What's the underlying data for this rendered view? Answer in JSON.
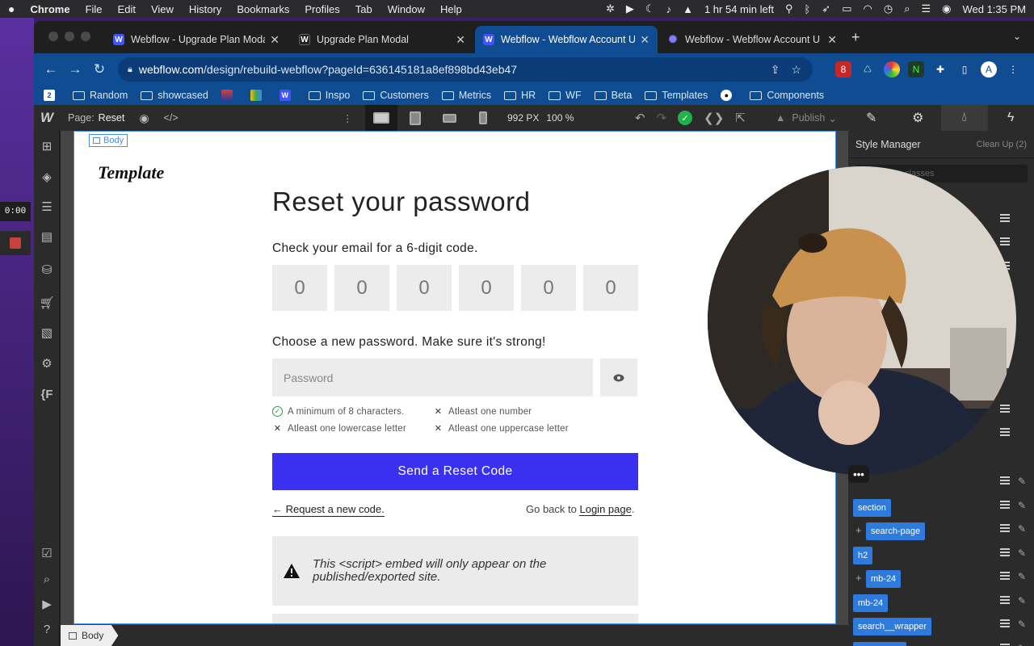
{
  "menubar": {
    "app": "Chrome",
    "items": [
      "File",
      "Edit",
      "View",
      "History",
      "Bookmarks",
      "Profiles",
      "Tab",
      "Window",
      "Help"
    ],
    "battery_text": "1 hr 54 min left",
    "datetime": "Wed  1:35 PM"
  },
  "recorder": {
    "time": "0:00"
  },
  "tabs": [
    {
      "label": "Webflow - Upgrade Plan Modal",
      "icon": "webflow-icon",
      "color": "#4353ff",
      "active": false
    },
    {
      "label": "Upgrade Plan Modal",
      "icon": "webflow-icon",
      "color": "#222222",
      "active": false
    },
    {
      "label": "Webflow - Webflow Account UI",
      "icon": "webflow-icon",
      "color": "#4353ff",
      "active": true
    },
    {
      "label": "Webflow - Webflow Account U",
      "icon": "gear-icon",
      "color": "#4353ff",
      "active": false
    }
  ],
  "address": {
    "host": "webflow.com",
    "path": "/design/rebuild-webflow?pageId=636145181a8ef898bd43eb47"
  },
  "bookmarks": [
    {
      "label": "",
      "kind": "app-icon"
    },
    {
      "label": "Random",
      "kind": "folder"
    },
    {
      "label": "showcased",
      "kind": "folder"
    },
    {
      "label": "",
      "kind": "app-icon"
    },
    {
      "label": "",
      "kind": "app-icon"
    },
    {
      "label": "",
      "kind": "webflow-icon"
    },
    {
      "label": "Inspo",
      "kind": "folder"
    },
    {
      "label": "Customers",
      "kind": "folder"
    },
    {
      "label": "Metrics",
      "kind": "folder"
    },
    {
      "label": "HR",
      "kind": "folder"
    },
    {
      "label": "WF",
      "kind": "folder"
    },
    {
      "label": "Beta",
      "kind": "folder"
    },
    {
      "label": "Templates",
      "kind": "folder"
    },
    {
      "label": "",
      "kind": "app-icon"
    },
    {
      "label": "Components",
      "kind": "folder"
    }
  ],
  "designer": {
    "page_label": "Page:",
    "page_name": "Reset",
    "width": "992 PX",
    "zoom": "100 %",
    "publish": "Publish",
    "body_tag": "Body",
    "breadcrumb": "Body"
  },
  "content": {
    "brand": "Template",
    "title": "Reset your password",
    "code_prompt": "Check your email for a 6-digit code.",
    "digits": [
      "0",
      "0",
      "0",
      "0",
      "0",
      "0"
    ],
    "pw_prompt": "Choose a new password. Make sure it's strong!",
    "pw_placeholder": "Password",
    "requirements": [
      {
        "text": "A minimum of 8 characters.",
        "met": true
      },
      {
        "text": "Atleast one number",
        "met": false
      },
      {
        "text": "Atleast one lowercase letter",
        "met": false
      },
      {
        "text": "Atleast one uppercase letter",
        "met": false
      }
    ],
    "send_button": "Send a Reset Code",
    "request_link": "← Request a new code.",
    "go_back_text": "Go back to ",
    "login_link": "Login page",
    "period": ".",
    "embed_notice": "This <script> embed will only appear on the published/exported site."
  },
  "style_manager": {
    "title": "Style Manager",
    "cleanup": "Clean Up (2)",
    "search_placeholder": "classes",
    "classes": [
      {
        "name": "section",
        "plus": false
      },
      {
        "name": "search-page",
        "plus": true
      },
      {
        "name": "h2",
        "plus": false
      },
      {
        "name": "mb-24",
        "plus": true
      },
      {
        "name": "mb-24",
        "plus": false
      },
      {
        "name": "search__wrapper",
        "plus": false
      },
      {
        "name": "search-text",
        "plus": false
      }
    ]
  },
  "colors": {
    "accent": "#3a31f0",
    "chrome_blue": "#0f4c92",
    "class_chip": "#2e7bdd"
  }
}
